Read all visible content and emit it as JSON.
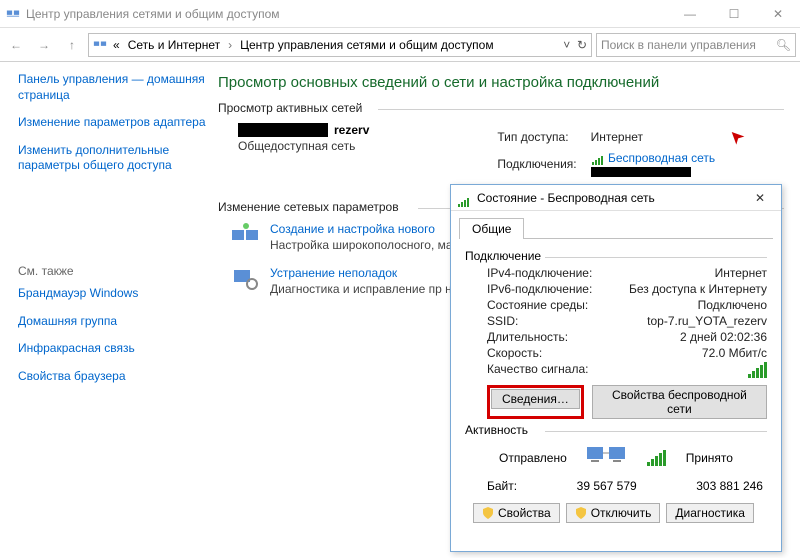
{
  "window": {
    "title": "Центр управления сетями и общим доступом"
  },
  "breadcrumbs": {
    "root_glyph": "«",
    "item1": "Сеть и Интернет",
    "item2": "Центр управления сетями и общим доступом"
  },
  "search": {
    "placeholder": "Поиск в панели управления"
  },
  "sidebar": {
    "links": [
      "Панель управления — домашняя страница",
      "Изменение параметров адаптера",
      "Изменить дополнительные параметры общего доступа"
    ],
    "see_also": "См. также",
    "related": [
      "Брандмауэр Windows",
      "Домашняя группа",
      "Инфракрасная связь",
      "Свойства браузера"
    ]
  },
  "page": {
    "heading": "Просмотр основных сведений о сети и настройка подключений",
    "active_nets": "Просмотр активных сетей",
    "change_params": "Изменение сетевых параметров"
  },
  "network": {
    "name_suffix": "rezerv",
    "scope": "Общедоступная сеть",
    "access_type_label": "Тип доступа:",
    "access_type_value": "Интернет",
    "connections_label": "Подключения:",
    "connections_value": "Беспроводная сеть"
  },
  "tasks": {
    "t1": {
      "title": "Создание и настройка нового ",
      "desc": "Настройка широкополосного, маршрутизатора или точки д"
    },
    "t2": {
      "title": "Устранение неполадок",
      "desc": "Диагностика и исправление пр неполадок."
    }
  },
  "dialog": {
    "title": "Состояние - Беспроводная сеть",
    "tab": "Общие",
    "section_conn": "Подключение",
    "rows": {
      "ipv4": {
        "k": "IPv4-подключение:",
        "v": "Интернет"
      },
      "ipv6": {
        "k": "IPv6-подключение:",
        "v": "Без доступа к Интернету"
      },
      "media": {
        "k": "Состояние среды:",
        "v": "Подключено"
      },
      "ssid": {
        "k": "SSID:",
        "v": "top-7.ru_YOTA_rezerv"
      },
      "duration": {
        "k": "Длительность:",
        "v": "2 дней 02:02:36"
      },
      "speed": {
        "k": "Скорость:",
        "v": "72.0 Мбит/с"
      },
      "signal": {
        "k": "Качество сигнала:"
      }
    },
    "btn_details": "Сведения…",
    "btn_wifi_props": "Свойства беспроводной сети",
    "section_activity": "Активность",
    "sent": "Отправлено",
    "recv": "Принято",
    "bytes_label": "Байт:",
    "bytes_sent": "39 567 579",
    "bytes_recv": "303 881 246",
    "btn_props": "Свойства",
    "btn_disable": "Отключить",
    "btn_diag": "Диагностика"
  }
}
